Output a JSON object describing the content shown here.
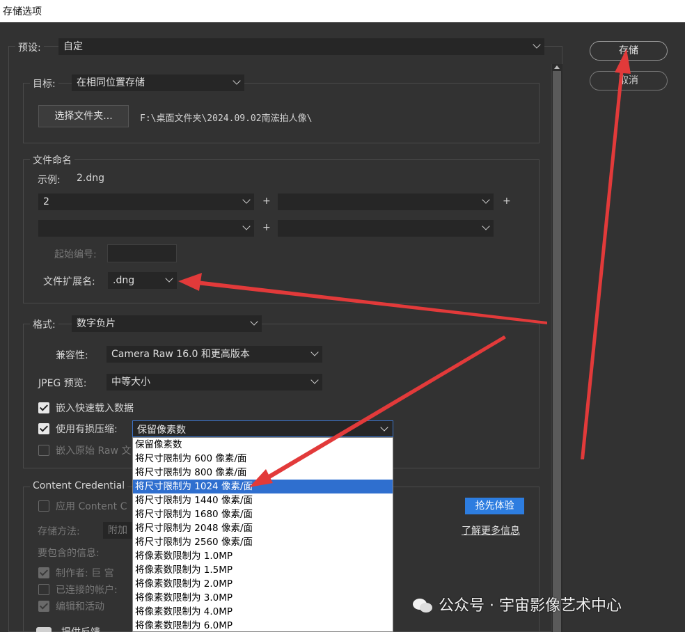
{
  "window": {
    "title": "存储选项"
  },
  "preset": {
    "label": "预设:",
    "value": "自定"
  },
  "actions": {
    "save": "存储",
    "cancel": "取消"
  },
  "target": {
    "label": "目标:",
    "value": "在相同位置存储",
    "choose_folder": "选择文件夹...",
    "path": "F:\\桌面文件夹\\2024.09.02南浤拍人像\\"
  },
  "naming": {
    "title": "文件命名",
    "example_label": "示例:",
    "example_value": "2.dng",
    "row1_left": "2",
    "row1_right": "",
    "row2_left": "",
    "row2_right": "",
    "plus": "+",
    "start_number_label": "起始编号:",
    "start_number_value": "",
    "extension_label": "文件扩展名:",
    "extension_value": ".dng"
  },
  "format": {
    "label": "格式:",
    "value": "数字负片",
    "compat_label": "兼容性:",
    "compat_value": "Camera Raw 16.0 和更高版本",
    "jpeg_label": "JPEG 预览:",
    "jpeg_value": "中等大小",
    "embed_fast": "嵌入快速载入数据",
    "lossy_label": "使用有损压缩:",
    "lossy_value": "保留像素数",
    "embed_raw": "嵌入原始 Raw 文"
  },
  "lossy_options": [
    "保留像素数",
    "将尺寸限制为 600 像素/面",
    "将尺寸限制为 800 像素/面",
    "将尺寸限制为 1024 像素/面",
    "将尺寸限制为 1440 像素/面",
    "将尺寸限制为 1680 像素/面",
    "将尺寸限制为 2048 像素/面",
    "将尺寸限制为 2560 像素/面",
    "将像素数限制为 1.0MP",
    "将像素数限制为 1.5MP",
    "将像素数限制为 2.0MP",
    "将像素数限制为 3.0MP",
    "将像素数限制为 4.0MP",
    "将像素数限制为 6.0MP"
  ],
  "content_credentials": {
    "title": "Content Credential",
    "apply": "应用 Content C",
    "storage_label": "存储方法:",
    "storage_value": "附加",
    "include_label": "要包含的信息:",
    "producer": "制作者: 巨 宫",
    "connected": "已连接的帐户: ",
    "edits": "编辑和活动",
    "feedback": "提供反馈",
    "try_button": "抢先体验",
    "learn_more": "了解更多信息"
  },
  "watermark": "公众号 · 宇宙影像艺术中心",
  "colors": {
    "accent": "#2f6fcf",
    "annotation_arrow": "#e23a3a"
  }
}
